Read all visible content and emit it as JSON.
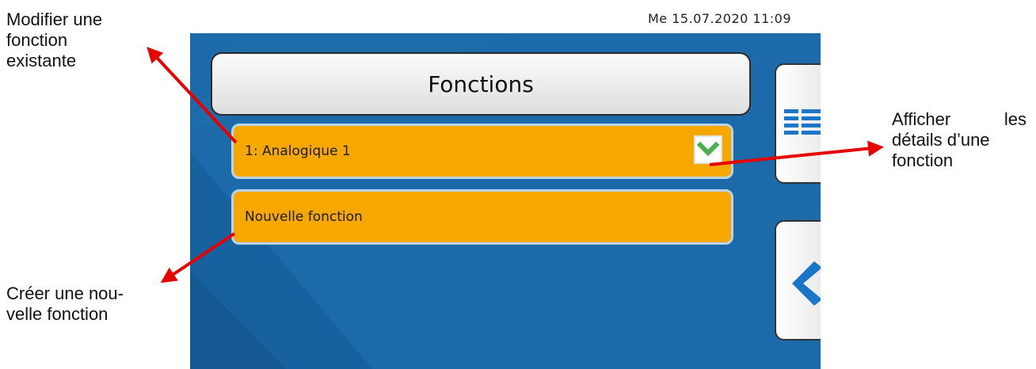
{
  "annotations": {
    "modify_lines": [
      "Modifier une",
      "fonction",
      "existante"
    ],
    "create_lines": [
      "Créer une nou-",
      "velle fonction"
    ],
    "details_line1_a": "Afficher",
    "details_line1_b": "les",
    "details_line2": "détails d’une",
    "details_line3": "fonction"
  },
  "status": {
    "datetime": "Me 15.07.2020  11:09"
  },
  "screen": {
    "title": "Fonctions",
    "rows": [
      {
        "label": "1: Analogique 1",
        "icon": "chevron-down-icon"
      },
      {
        "label": "Nouvelle fonction"
      }
    ],
    "side_buttons": [
      {
        "icon": "details-list-icon"
      },
      {
        "icon": "back-arrow-icon"
      }
    ]
  },
  "colors": {
    "background": "#1c6aa9",
    "row_fill": "#f7a800",
    "arrow": "#e60000",
    "check": "#4caf50",
    "icon_blue": "#1976c8"
  }
}
